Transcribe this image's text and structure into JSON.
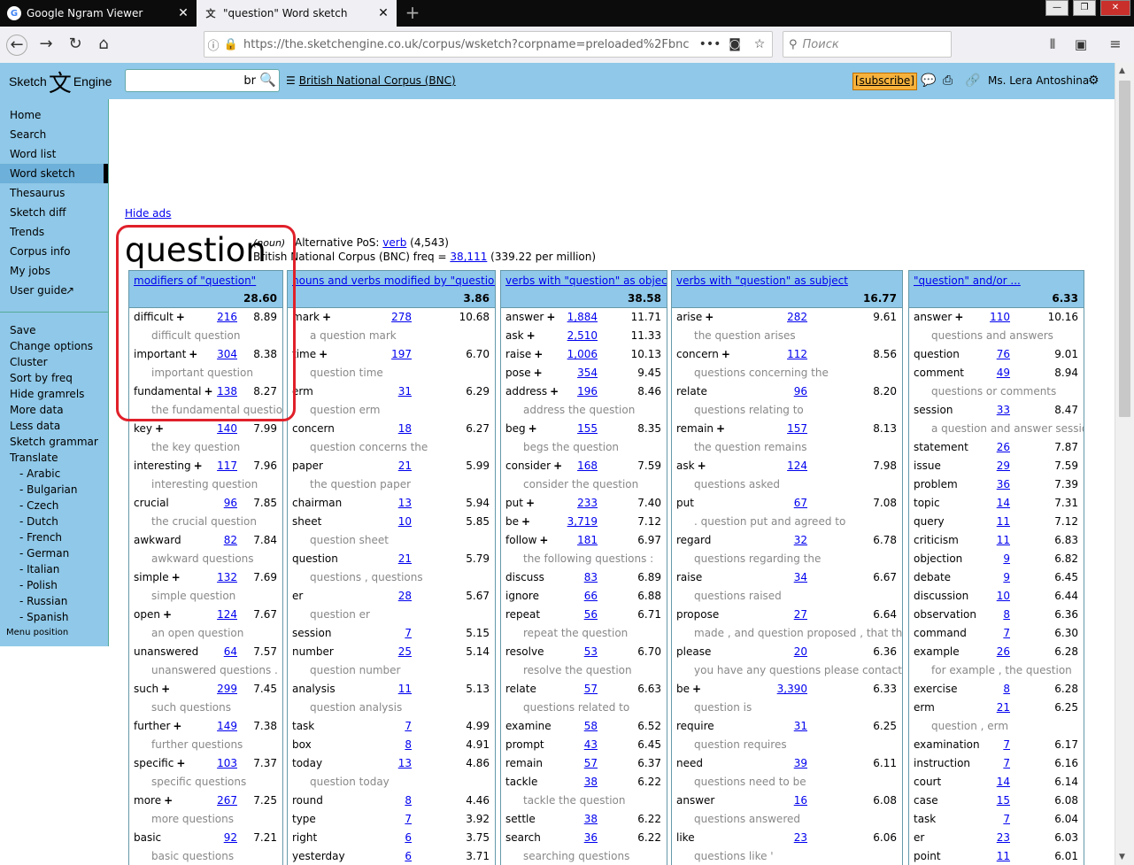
{
  "browser": {
    "tabs": [
      {
        "title": "Google Ngram Viewer",
        "icon": "google-g-icon"
      },
      {
        "title": "\"question\" Word sketch",
        "icon": "sketch-engine-favicon"
      }
    ],
    "url": "https://the.sketchengine.co.uk/corpus/wsketch?corpname=preloaded%2Fbnc",
    "search_placeholder": "Поиск"
  },
  "header": {
    "logo_left": "Sketch",
    "logo_kanji": "文",
    "logo_right": "Engine",
    "query_value": "br",
    "corpus_name": "British National Corpus (BNC)",
    "subscribe": "[subscribe]",
    "user": "Ms. Lera Antoshina"
  },
  "sidebar": {
    "items": [
      "Home",
      "Search",
      "Word list",
      "Word sketch",
      "Thesaurus",
      "Sketch diff",
      "Trends",
      "Corpus info",
      "My jobs",
      "User guide"
    ],
    "active": "Word sketch",
    "actions": [
      "Save",
      "Change options",
      "Cluster",
      "Sort by freq",
      "Hide gramrels",
      "More data",
      "Less data",
      "Sketch grammar",
      "Translate"
    ],
    "languages": [
      "- Arabic",
      "- Bulgarian",
      "- Czech",
      "- Dutch",
      "- French",
      "- German",
      "- Italian",
      "- Polish",
      "- Russian",
      "- Spanish"
    ],
    "menu_position": "Menu position"
  },
  "main": {
    "hide_ads": "Hide ads",
    "headword": "question",
    "pos": "(noun)",
    "alt_pos_label": "Alternative PoS:",
    "alt_pos_link": "verb",
    "alt_pos_count": "(4,543)",
    "freq_label": "British National Corpus (BNC) freq =",
    "freq_link": "38,111",
    "freq_per_million": "(339.22 per million)"
  },
  "columns": [
    {
      "title": "modifiers of \"question\"",
      "score": "28.60",
      "entries": [
        {
          "w": "difficult",
          "plus": true,
          "f": "216",
          "s": "8.89",
          "ex": "difficult question"
        },
        {
          "w": "important",
          "plus": true,
          "f": "304",
          "s": "8.38",
          "ex": "important question"
        },
        {
          "w": "fundamental",
          "plus": true,
          "f": "138",
          "s": "8.27",
          "ex": "the fundamental question"
        },
        {
          "w": "key",
          "plus": true,
          "f": "140",
          "s": "7.99",
          "ex": "the key question"
        },
        {
          "w": "interesting",
          "plus": true,
          "f": "117",
          "s": "7.96",
          "ex": "interesting question"
        },
        {
          "w": "crucial",
          "plus": false,
          "f": "96",
          "s": "7.85",
          "ex": "the crucial question"
        },
        {
          "w": "awkward",
          "plus": false,
          "f": "82",
          "s": "7.84",
          "ex": "awkward questions"
        },
        {
          "w": "simple",
          "plus": true,
          "f": "132",
          "s": "7.69",
          "ex": "simple question"
        },
        {
          "w": "open",
          "plus": true,
          "f": "124",
          "s": "7.67",
          "ex": "an open question"
        },
        {
          "w": "unanswered",
          "plus": false,
          "f": "64",
          "s": "7.57",
          "ex": "unanswered questions ."
        },
        {
          "w": "such",
          "plus": true,
          "f": "299",
          "s": "7.45",
          "ex": "such questions"
        },
        {
          "w": "further",
          "plus": true,
          "f": "149",
          "s": "7.38",
          "ex": "further questions"
        },
        {
          "w": "specific",
          "plus": true,
          "f": "103",
          "s": "7.37",
          "ex": "specific questions"
        },
        {
          "w": "more",
          "plus": true,
          "f": "267",
          "s": "7.25",
          "ex": "more questions"
        },
        {
          "w": "basic",
          "plus": false,
          "f": "92",
          "s": "7.21",
          "ex": "basic questions"
        }
      ]
    },
    {
      "title": "nouns and verbs modified by \"question\"",
      "score": "3.86",
      "entries": [
        {
          "w": "mark",
          "plus": true,
          "f": "278",
          "s": "10.68",
          "ex": "a question mark"
        },
        {
          "w": "time",
          "plus": true,
          "f": "197",
          "s": "6.70",
          "ex": "question time"
        },
        {
          "w": "erm",
          "plus": false,
          "f": "31",
          "s": "6.29",
          "ex": "question erm"
        },
        {
          "w": "concern",
          "plus": false,
          "f": "18",
          "s": "6.27",
          "ex": "question concerns the"
        },
        {
          "w": "paper",
          "plus": false,
          "f": "21",
          "s": "5.99",
          "ex": "the question paper"
        },
        {
          "w": "chairman",
          "plus": false,
          "f": "13",
          "s": "5.94"
        },
        {
          "w": "sheet",
          "plus": false,
          "f": "10",
          "s": "5.85",
          "ex": "question sheet"
        },
        {
          "w": "question",
          "plus": false,
          "f": "21",
          "s": "5.79",
          "ex": "questions , questions"
        },
        {
          "w": "er",
          "plus": false,
          "f": "28",
          "s": "5.67",
          "ex": "question er"
        },
        {
          "w": "session",
          "plus": false,
          "f": "7",
          "s": "5.15"
        },
        {
          "w": "number",
          "plus": false,
          "f": "25",
          "s": "5.14",
          "ex": "question number"
        },
        {
          "w": "analysis",
          "plus": false,
          "f": "11",
          "s": "5.13",
          "ex": "question analysis"
        },
        {
          "w": "task",
          "plus": false,
          "f": "7",
          "s": "4.99"
        },
        {
          "w": "box",
          "plus": false,
          "f": "8",
          "s": "4.91"
        },
        {
          "w": "today",
          "plus": false,
          "f": "13",
          "s": "4.86",
          "ex": "question today"
        },
        {
          "w": "round",
          "plus": false,
          "f": "8",
          "s": "4.46"
        },
        {
          "w": "type",
          "plus": false,
          "f": "7",
          "s": "3.92"
        },
        {
          "w": "right",
          "plus": false,
          "f": "6",
          "s": "3.75"
        },
        {
          "w": "yesterday",
          "plus": false,
          "f": "6",
          "s": "3.71"
        }
      ]
    },
    {
      "title": "verbs with \"question\" as object",
      "score": "38.58",
      "entries": [
        {
          "w": "answer",
          "plus": true,
          "f": "1,884",
          "s": "11.71"
        },
        {
          "w": "ask",
          "plus": true,
          "f": "2,510",
          "s": "11.33"
        },
        {
          "w": "raise",
          "plus": true,
          "f": "1,006",
          "s": "10.13"
        },
        {
          "w": "pose",
          "plus": true,
          "f": "354",
          "s": "9.45"
        },
        {
          "w": "address",
          "plus": true,
          "f": "196",
          "s": "8.46",
          "ex": "address the question"
        },
        {
          "w": "beg",
          "plus": true,
          "f": "155",
          "s": "8.35",
          "ex": "begs the question"
        },
        {
          "w": "consider",
          "plus": true,
          "f": "168",
          "s": "7.59",
          "ex": "consider the question"
        },
        {
          "w": "put",
          "plus": true,
          "f": "233",
          "s": "7.40"
        },
        {
          "w": "be",
          "plus": true,
          "f": "3,719",
          "s": "7.12"
        },
        {
          "w": "follow",
          "plus": true,
          "f": "181",
          "s": "6.97",
          "ex": "the following questions :"
        },
        {
          "w": "discuss",
          "plus": false,
          "f": "83",
          "s": "6.89"
        },
        {
          "w": "ignore",
          "plus": false,
          "f": "66",
          "s": "6.88"
        },
        {
          "w": "repeat",
          "plus": false,
          "f": "56",
          "s": "6.71",
          "ex": "repeat the question"
        },
        {
          "w": "resolve",
          "plus": false,
          "f": "53",
          "s": "6.70",
          "ex": "resolve the question"
        },
        {
          "w": "relate",
          "plus": false,
          "f": "57",
          "s": "6.63",
          "ex": "questions related to"
        },
        {
          "w": "examine",
          "plus": false,
          "f": "58",
          "s": "6.52"
        },
        {
          "w": "prompt",
          "plus": false,
          "f": "43",
          "s": "6.45"
        },
        {
          "w": "remain",
          "plus": false,
          "f": "57",
          "s": "6.37"
        },
        {
          "w": "tackle",
          "plus": false,
          "f": "38",
          "s": "6.22",
          "ex": "tackle the question"
        },
        {
          "w": "settle",
          "plus": false,
          "f": "38",
          "s": "6.22"
        },
        {
          "w": "search",
          "plus": false,
          "f": "36",
          "s": "6.22",
          "ex": "searching questions"
        }
      ]
    },
    {
      "title": "verbs with \"question\" as subject",
      "score": "16.77",
      "entries": [
        {
          "w": "arise",
          "plus": true,
          "f": "282",
          "s": "9.61",
          "ex": "the question arises"
        },
        {
          "w": "concern",
          "plus": true,
          "f": "112",
          "s": "8.56",
          "ex": "questions concerning the"
        },
        {
          "w": "relate",
          "plus": false,
          "f": "96",
          "s": "8.20",
          "ex": "questions relating to"
        },
        {
          "w": "remain",
          "plus": true,
          "f": "157",
          "s": "8.13",
          "ex": "the question remains"
        },
        {
          "w": "ask",
          "plus": true,
          "f": "124",
          "s": "7.98",
          "ex": "questions asked"
        },
        {
          "w": "put",
          "plus": false,
          "f": "67",
          "s": "7.08",
          "ex": ". question put and agreed to"
        },
        {
          "w": "regard",
          "plus": false,
          "f": "32",
          "s": "6.78",
          "ex": "questions regarding the"
        },
        {
          "w": "raise",
          "plus": false,
          "f": "34",
          "s": "6.67",
          "ex": "questions raised"
        },
        {
          "w": "propose",
          "plus": false,
          "f": "27",
          "s": "6.64",
          "ex": "made , and question proposed , that this"
        },
        {
          "w": "please",
          "plus": false,
          "f": "20",
          "s": "6.36",
          "ex": "you have any questions please contact : ("
        },
        {
          "w": "be",
          "plus": true,
          "f": "3,390",
          "s": "6.33",
          "ex": "question is"
        },
        {
          "w": "require",
          "plus": false,
          "f": "31",
          "s": "6.25",
          "ex": "question requires"
        },
        {
          "w": "need",
          "plus": false,
          "f": "39",
          "s": "6.11",
          "ex": "questions need to be"
        },
        {
          "w": "answer",
          "plus": false,
          "f": "16",
          "s": "6.08",
          "ex": "questions answered"
        },
        {
          "w": "like",
          "plus": false,
          "f": "23",
          "s": "6.06",
          "ex": "questions like '"
        }
      ]
    },
    {
      "title": "\"question\" and/or ...",
      "score": "6.33",
      "entries": [
        {
          "w": "answer",
          "plus": true,
          "f": "110",
          "s": "10.16",
          "ex": "questions and answers"
        },
        {
          "w": "question",
          "plus": false,
          "f": "76",
          "s": "9.01"
        },
        {
          "w": "comment",
          "plus": false,
          "f": "49",
          "s": "8.94",
          "ex": "questions or comments"
        },
        {
          "w": "session",
          "plus": false,
          "f": "33",
          "s": "8.47",
          "ex": "a question and answer session"
        },
        {
          "w": "statement",
          "plus": false,
          "f": "26",
          "s": "7.87"
        },
        {
          "w": "issue",
          "plus": false,
          "f": "29",
          "s": "7.59"
        },
        {
          "w": "problem",
          "plus": false,
          "f": "36",
          "s": "7.39"
        },
        {
          "w": "topic",
          "plus": false,
          "f": "14",
          "s": "7.31"
        },
        {
          "w": "query",
          "plus": false,
          "f": "11",
          "s": "7.12"
        },
        {
          "w": "criticism",
          "plus": false,
          "f": "11",
          "s": "6.83"
        },
        {
          "w": "objection",
          "plus": false,
          "f": "9",
          "s": "6.82"
        },
        {
          "w": "debate",
          "plus": false,
          "f": "9",
          "s": "6.45"
        },
        {
          "w": "discussion",
          "plus": false,
          "f": "10",
          "s": "6.44"
        },
        {
          "w": "observation",
          "plus": false,
          "f": "8",
          "s": "6.36"
        },
        {
          "w": "command",
          "plus": false,
          "f": "7",
          "s": "6.30"
        },
        {
          "w": "example",
          "plus": false,
          "f": "26",
          "s": "6.28",
          "ex": "for example , the question"
        },
        {
          "w": "exercise",
          "plus": false,
          "f": "8",
          "s": "6.28"
        },
        {
          "w": "erm",
          "plus": false,
          "f": "21",
          "s": "6.25",
          "ex": "question , erm"
        },
        {
          "w": "examination",
          "plus": false,
          "f": "7",
          "s": "6.17"
        },
        {
          "w": "instruction",
          "plus": false,
          "f": "7",
          "s": "6.16"
        },
        {
          "w": "court",
          "plus": false,
          "f": "14",
          "s": "6.14"
        },
        {
          "w": "case",
          "plus": false,
          "f": "15",
          "s": "6.08"
        },
        {
          "w": "task",
          "plus": false,
          "f": "7",
          "s": "6.04"
        },
        {
          "w": "er",
          "plus": false,
          "f": "23",
          "s": "6.03"
        },
        {
          "w": "point",
          "plus": false,
          "f": "11",
          "s": "6.01"
        }
      ]
    }
  ]
}
